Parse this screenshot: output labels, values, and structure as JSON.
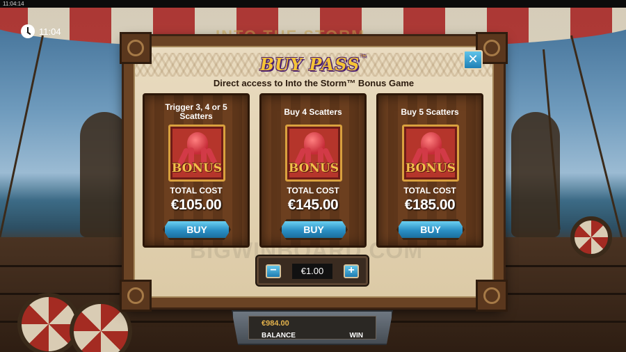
{
  "system_bar": {
    "time": "11:04:14"
  },
  "clock": {
    "time": "11:04"
  },
  "dialog": {
    "title": "BUY PASS",
    "title_mark": "™",
    "subtitle": "Direct access to Into the Storm™ Bonus Game",
    "close_label": "✕",
    "cards": [
      {
        "title": "Trigger 3, 4 or 5 Scatters",
        "icon_label": "BONUS",
        "cost_label": "TOTAL COST",
        "price": "€105.00",
        "button": "BUY"
      },
      {
        "title": "Buy 4 Scatters",
        "icon_label": "BONUS",
        "cost_label": "TOTAL COST",
        "price": "€145.00",
        "button": "BUY"
      },
      {
        "title": "Buy 5 Scatters",
        "icon_label": "BONUS",
        "cost_label": "TOTAL COST",
        "price": "€185.00",
        "button": "BUY"
      }
    ],
    "stake": {
      "minus": "−",
      "value": "€1.00",
      "plus": "+"
    }
  },
  "watermark": "BIGWINBOARD.COM",
  "background_title": "INTO THE STORM",
  "bottom_bar": {
    "balance_value": "€984.00",
    "balance_label": "BALANCE",
    "win_label": "WIN"
  },
  "colors": {
    "accent_blue": "#2a8fc4",
    "title_gold": "#f4c437",
    "title_outline": "#4a1e70",
    "parchment": "#e9dbc0",
    "wood": "#6c3f1f"
  },
  "icons": {
    "clock": "clock-icon",
    "bonus_symbol": "kraken-bonus-icon"
  }
}
